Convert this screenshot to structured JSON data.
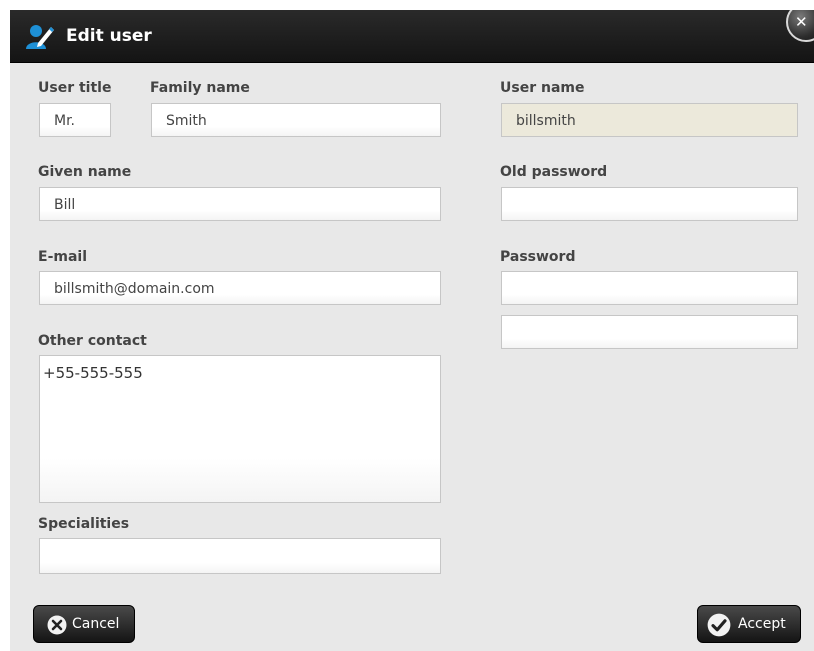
{
  "dialog": {
    "title": "Edit user",
    "title_icon": "user-edit-icon",
    "close_icon": "close-icon",
    "close_glyph": "✕"
  },
  "form": {
    "user_title": {
      "label": "User title",
      "value": "Mr."
    },
    "family_name": {
      "label": "Family name",
      "value": "Smith"
    },
    "given_name": {
      "label": "Given name",
      "value": "Bill"
    },
    "email": {
      "label": "E-mail",
      "value": "billsmith@domain.com"
    },
    "other_contact": {
      "label": "Other contact",
      "value": "+55-555-555"
    },
    "specialities": {
      "label": "Specialities",
      "value": ""
    },
    "user_name": {
      "label": "User name",
      "value": "billsmith"
    },
    "old_password": {
      "label": "Old password",
      "value": ""
    },
    "password": {
      "label": "Password",
      "value": "",
      "confirm_value": ""
    }
  },
  "buttons": {
    "cancel_label": "Cancel",
    "cancel_icon": "x-circle-icon",
    "accept_label": "Accept",
    "accept_icon": "check-circle-icon"
  },
  "colors": {
    "titlebar": "#1c1c1c",
    "body": "#e8e8e8",
    "disabled_field": "#ece9db",
    "accent_icon": "#1e90d6"
  }
}
